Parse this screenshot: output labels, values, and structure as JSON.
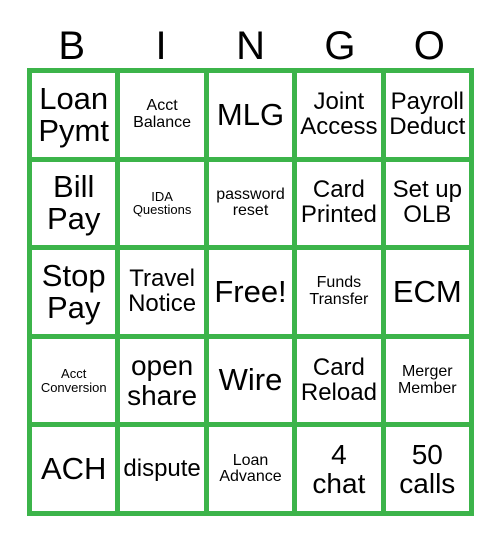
{
  "card": {
    "headers": [
      "B",
      "I",
      "N",
      "G",
      "O"
    ],
    "colors": {
      "grid_line": "#3cb44a",
      "cell_background": "#ffffff",
      "text": "#000000",
      "page_background": "#ffffff"
    },
    "rows": [
      [
        {
          "text": "Loan\nPymt",
          "size": "fs-xl"
        },
        {
          "text": "Acct\nBalance",
          "size": "fs-sm"
        },
        {
          "text": "MLG",
          "size": "fs-xl"
        },
        {
          "text": "Joint\nAccess",
          "size": "fs-md"
        },
        {
          "text": "Payroll\nDeduct",
          "size": "fs-md"
        }
      ],
      [
        {
          "text": "Bill\nPay",
          "size": "fs-xl"
        },
        {
          "text": "IDA\nQuestions",
          "size": "fs-xs"
        },
        {
          "text": "password\nreset",
          "size": "fs-sm"
        },
        {
          "text": "Card\nPrinted",
          "size": "fs-md"
        },
        {
          "text": "Set up\nOLB",
          "size": "fs-md"
        }
      ],
      [
        {
          "text": "Stop\nPay",
          "size": "fs-xl"
        },
        {
          "text": "Travel\nNotice",
          "size": "fs-md"
        },
        {
          "text": "Free!",
          "size": "fs-xl"
        },
        {
          "text": "Funds\nTransfer",
          "size": "fs-sm"
        },
        {
          "text": "ECM",
          "size": "fs-xl"
        }
      ],
      [
        {
          "text": "Acct\nConversion",
          "size": "fs-xs"
        },
        {
          "text": "open\nshare",
          "size": "fs-lg"
        },
        {
          "text": "Wire",
          "size": "fs-xl"
        },
        {
          "text": "Card\nReload",
          "size": "fs-md"
        },
        {
          "text": "Merger\nMember",
          "size": "fs-sm"
        }
      ],
      [
        {
          "text": "ACH",
          "size": "fs-xl"
        },
        {
          "text": "dispute",
          "size": "fs-md"
        },
        {
          "text": "Loan\nAdvance",
          "size": "fs-sm"
        },
        {
          "text": "4\nchat",
          "size": "fs-lg"
        },
        {
          "text": "50\ncalls",
          "size": "fs-lg"
        }
      ]
    ]
  }
}
